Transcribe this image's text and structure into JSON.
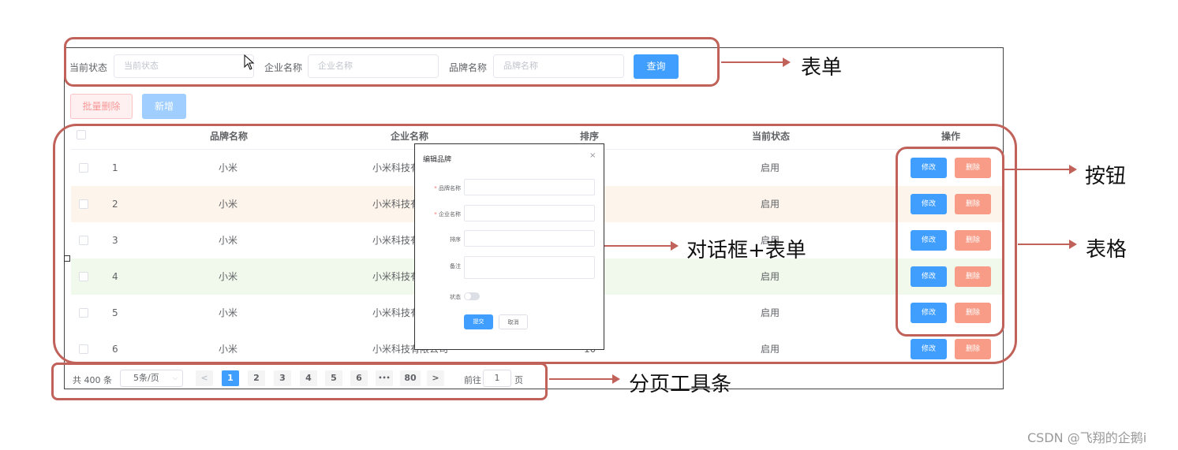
{
  "search_form": {
    "status_label": "当前状态",
    "status_placeholder": "当前状态",
    "company_label": "企业名称",
    "company_placeholder": "企业名称",
    "brand_label": "品牌名称",
    "brand_placeholder": "品牌名称",
    "query_button": "查询"
  },
  "toolbar": {
    "batch_delete": "批量删除",
    "add": "新增"
  },
  "table": {
    "headers": [
      "品牌名称",
      "企业名称",
      "排序",
      "当前状态",
      "操作"
    ],
    "rows": [
      {
        "index": "1",
        "brand": "小米",
        "company": "小米科技有",
        "status": "启用"
      },
      {
        "index": "2",
        "brand": "小米",
        "company": "小米科技有",
        "status": "启用"
      },
      {
        "index": "3",
        "brand": "小米",
        "company": "小米科技有",
        "status": "启用"
      },
      {
        "index": "4",
        "brand": "小米",
        "company": "小米科技有",
        "status": "启用"
      },
      {
        "index": "5",
        "brand": "小米",
        "company": "小米科技有",
        "status": "启用"
      },
      {
        "index": "6",
        "brand": "小米",
        "company": "小米科技有限公司",
        "sort": "10",
        "status": "启用"
      }
    ],
    "edit_label": "修改",
    "delete_label": "删除"
  },
  "dialog": {
    "title": "编辑品牌",
    "close": "×",
    "fields": {
      "brand": "品牌名称",
      "company": "企业名称",
      "sort": "排序",
      "remark": "备注",
      "status": "状态"
    },
    "submit": "提交",
    "cancel": "取消"
  },
  "pagination": {
    "total": "共 400 条",
    "page_size": "5条/页",
    "prev": "<",
    "pages": [
      "1",
      "2",
      "3",
      "4",
      "5",
      "6",
      "•••",
      "80"
    ],
    "next": ">",
    "goto_label": "前往",
    "goto_value": "1",
    "page_unit": "页"
  },
  "annotations": {
    "form": "表单",
    "button": "按钮",
    "table": "表格",
    "dialog_form": "对话框+表单",
    "pagination": "分页工具条"
  },
  "watermark": "CSDN @飞翔的企鹅i",
  "colors": {
    "primary": "#409eff",
    "danger": "#f89c87",
    "annotation_red": "#c0625a",
    "row_highlight_orange": "#fdf5eb",
    "row_highlight_green": "#f0f9eb"
  }
}
